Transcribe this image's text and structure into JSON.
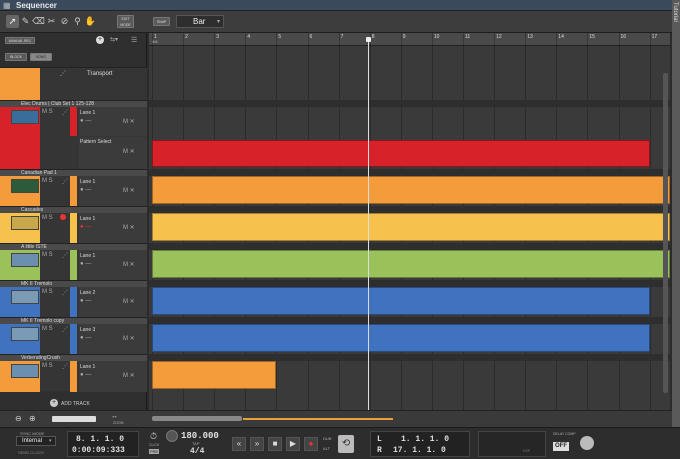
{
  "window": {
    "title": "Sequencer",
    "side_tab": "Tutorial"
  },
  "toolbar": {
    "tools": [
      "pointer",
      "pencil",
      "eraser",
      "razor",
      "mute",
      "magnify",
      "hand"
    ],
    "edit_mode_label": "EDIT\nMODE",
    "snap_label": "SNAP",
    "snap_value": "Bar"
  },
  "controls": {
    "manual_rec": "MANUAL REC",
    "block": "BLOCK",
    "song": "SONG",
    "add_track": "ADD TRACK"
  },
  "ruler": {
    "bars": [
      "1",
      "2",
      "3",
      "4",
      "5",
      "6",
      "7",
      "8",
      "9",
      "10",
      "11",
      "12",
      "13",
      "14",
      "15",
      "16",
      "17"
    ],
    "time_signature": "4/4"
  },
  "tracks": [
    {
      "name": "Transport",
      "lanes": []
    },
    {
      "name": "Elec Drums | Club Set 1 125-128",
      "lanes": [
        "Lane 1",
        "Pattern Select"
      ]
    },
    {
      "name": "Canadian Pad 1",
      "lanes": [
        "Lane 1"
      ]
    },
    {
      "name": "Cascades",
      "lanes": [
        "Lane 1"
      ]
    },
    {
      "name": "A little ISTE",
      "lanes": [
        "Lane 1"
      ]
    },
    {
      "name": "MK II Tremolo",
      "lanes": [
        "Lane 2"
      ]
    },
    {
      "name": "MK II Tremolo copy",
      "lanes": [
        "Lane 3"
      ]
    },
    {
      "name": "VerberatingCrush",
      "lanes": [
        "Lane 1"
      ]
    }
  ],
  "colors": {
    "drums": "#d8222a",
    "orange": "#f49c3c",
    "yellow": "#f7c24b",
    "green": "#9bc15a",
    "blue": "#3f73bf"
  },
  "transport": {
    "sync_mode_label": "SYNC MODE",
    "sync_mode_value": "Internal",
    "send_clock": "SEND CLOCK",
    "position_bars": "8. 1. 1. 0",
    "position_time": "0:00:09:333",
    "click_label": "CLICK",
    "pre_label": "PRE",
    "tempo": "180.000",
    "tap_label": "TAP",
    "signature": "4/4",
    "loop_left": "1. 1. 1. 0",
    "loop_right": "17. 1. 1. 0",
    "l_label": "L",
    "r_label": "R",
    "dub_label": "DUB",
    "alt_label": "ALT",
    "delay_comp_label": "DELAY COMP",
    "delay_comp_value": "OFF",
    "cpu_label": "DSP",
    "zoom_label": "ZOOM"
  }
}
